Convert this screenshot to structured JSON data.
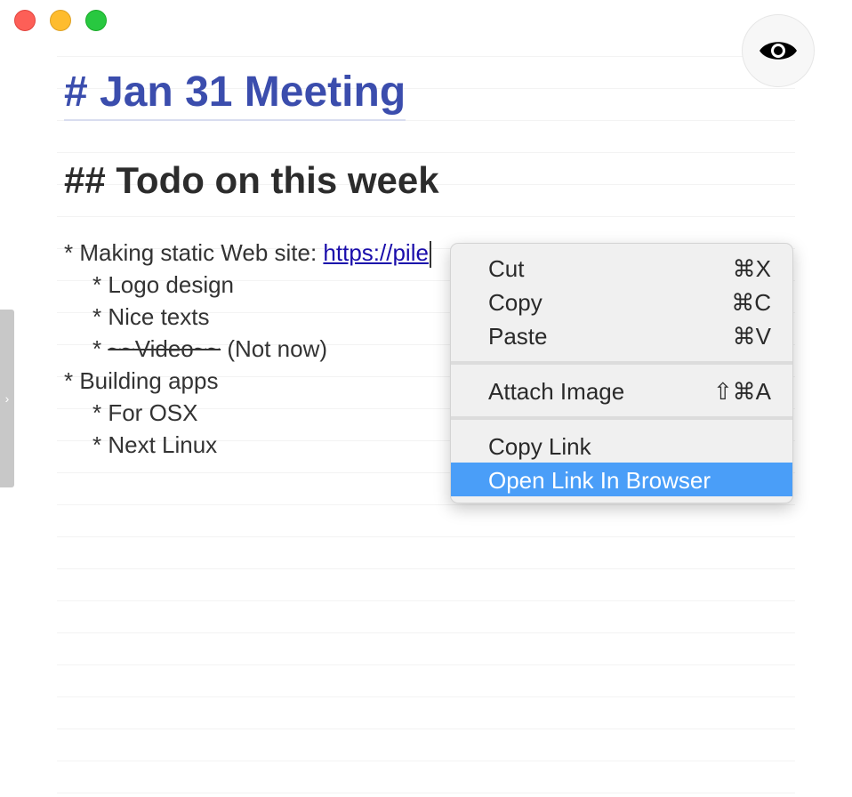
{
  "editor": {
    "h1": "# Jan 31 Meeting",
    "h2": "## Todo on this week",
    "lines": {
      "l1_prefix": "* Making static Web site: ",
      "l1_link": "https://pile",
      "l2": "* Logo design",
      "l3": "* Nice texts",
      "l4_prefix": "* ",
      "l4_strike": "~~Video~~",
      "l4_suffix": " (Not now)",
      "l5": "* Building apps",
      "l6": "* For OSX",
      "l7": "* Next Linux"
    }
  },
  "context_menu": {
    "cut": {
      "label": "Cut",
      "shortcut": "⌘X"
    },
    "copy": {
      "label": "Copy",
      "shortcut": "⌘C"
    },
    "paste": {
      "label": "Paste",
      "shortcut": "⌘V"
    },
    "attach_image": {
      "label": "Attach Image",
      "shortcut": "⇧⌘A"
    },
    "copy_link": {
      "label": "Copy Link"
    },
    "open_link": {
      "label": "Open Link In Browser"
    }
  },
  "icons": {
    "preview": "eye-icon",
    "sidebar_toggle": "chevron-right-icon"
  },
  "colors": {
    "heading1": "#3b4dad",
    "link": "#1a0dab",
    "menu_highlight": "#4a9ef8"
  },
  "sidebar_toggle_glyph": "›"
}
